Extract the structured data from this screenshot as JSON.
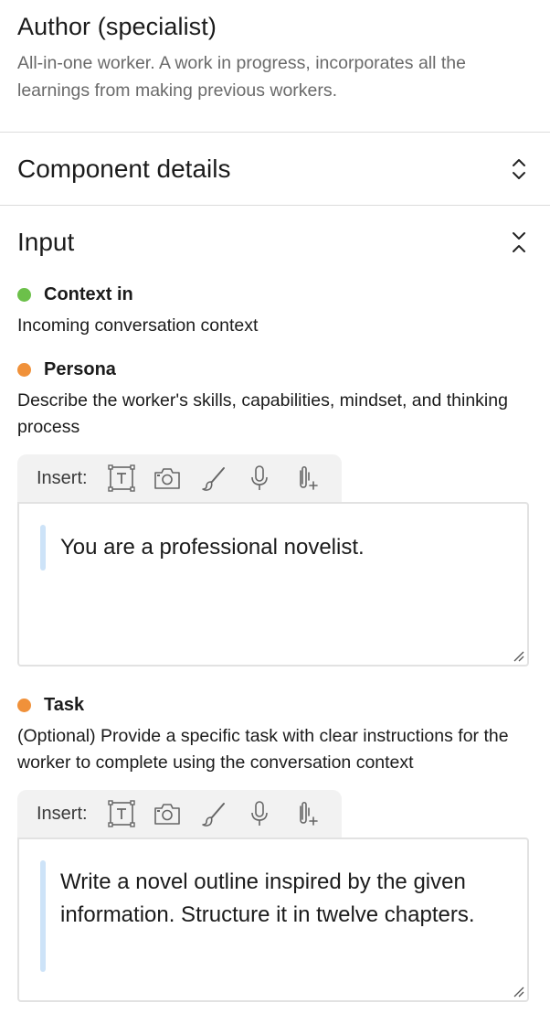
{
  "header": {
    "title": "Author (specialist)",
    "description": "All-in-one worker. A work in progress, incorporates all the learnings from making previous workers."
  },
  "sections": {
    "component_details": "Component details",
    "input": "Input"
  },
  "fields": {
    "context": {
      "name": "Context in",
      "description": "Incoming conversation context",
      "dot_color": "#6cc04a"
    },
    "persona": {
      "name": "Persona",
      "description": "Describe the worker's skills, capabilities, mindset, and thinking process",
      "dot_color": "#f0913a",
      "toolbar_label": "Insert:",
      "value": "You are a professional novelist."
    },
    "task": {
      "name": "Task",
      "description": "(Optional) Provide a specific task with clear instructions for the worker to complete using the conversation context",
      "dot_color": "#f0913a",
      "toolbar_label": "Insert:",
      "value": "Write a novel outline inspired by the given information. Structure it in twelve chapters."
    }
  },
  "toolbar_icons": [
    "text-box-icon",
    "camera-icon",
    "brush-icon",
    "microphone-icon",
    "attachment-add-icon"
  ]
}
